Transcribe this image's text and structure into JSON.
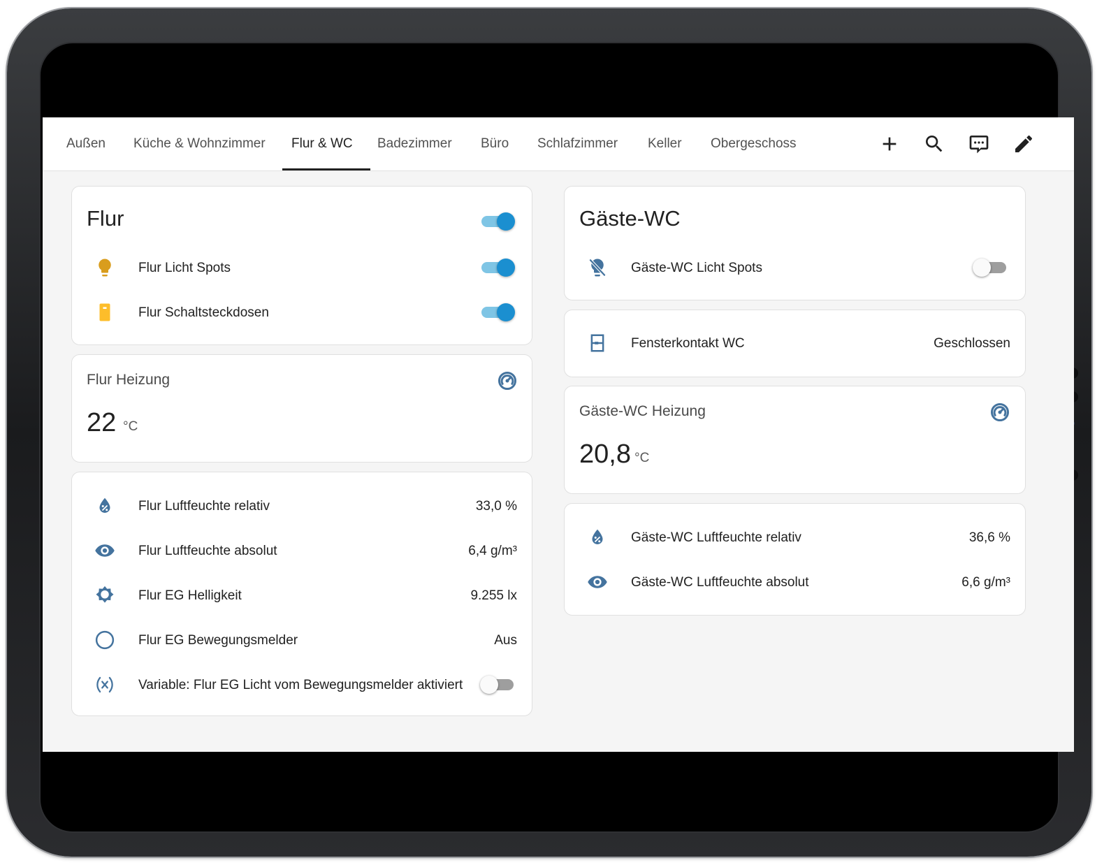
{
  "tabs": [
    {
      "label": "Außen",
      "active": false
    },
    {
      "label": "Küche & Wohnzimmer",
      "active": false
    },
    {
      "label": "Flur & WC",
      "active": true
    },
    {
      "label": "Badezimmer",
      "active": false
    },
    {
      "label": "Büro",
      "active": false
    },
    {
      "label": "Schlafzimmer",
      "active": false
    },
    {
      "label": "Keller",
      "active": false
    },
    {
      "label": "Obergeschoss",
      "active": false
    }
  ],
  "actions": {
    "add": "plus-icon",
    "search": "search-icon",
    "assist": "comment-processing-icon",
    "edit": "pencil-icon"
  },
  "colors": {
    "icon_blue": "#44739e",
    "bulb_on": "#d99d1d",
    "socket_on": "#fdbd2a",
    "toggle_on": "#1b8fd0",
    "toggle_on_track": "#7fc5e5"
  },
  "flur_card": {
    "title": "Flur",
    "master_toggle": "on",
    "rows": [
      {
        "icon": "lightbulb-icon",
        "label": "Flur Licht Spots",
        "state": "on"
      },
      {
        "icon": "power-socket-icon",
        "label": "Flur Schaltsteckdosen",
        "state": "on"
      }
    ]
  },
  "flur_heating": {
    "name": "Flur Heizung",
    "icon": "thermostat-icon",
    "value": "22",
    "unit": "°C"
  },
  "flur_sensors": {
    "rows": [
      {
        "icon": "water-percent-icon",
        "label": "Flur Luftfeuchte relativ",
        "value": "33,0 %"
      },
      {
        "icon": "eye-icon",
        "label": "Flur Luftfeuchte absolut",
        "value": "6,4 g/m³"
      },
      {
        "icon": "brightness-icon",
        "label": "Flur EG Helligkeit",
        "value": "9.255 lx"
      },
      {
        "icon": "circle-outline-icon",
        "label": "Flur EG Bewegungsmelder",
        "value": "Aus"
      },
      {
        "icon": "variable-icon",
        "label": "Variable: Flur EG Licht vom Bewegungsmelder aktiviert",
        "state": "off"
      }
    ]
  },
  "gaeste_card": {
    "title": "Gäste-WC",
    "rows": [
      {
        "icon": "lightbulb-off-icon",
        "label": "Gäste-WC Licht Spots",
        "state": "off"
      }
    ]
  },
  "window_card": {
    "icon": "window-closed-icon",
    "label": "Fensterkontakt WC",
    "value": "Geschlossen"
  },
  "gaeste_heating": {
    "name": "Gäste-WC Heizung",
    "icon": "thermostat-icon",
    "value": "20,8",
    "unit": "°C"
  },
  "gaeste_sensors": {
    "rows": [
      {
        "icon": "water-percent-icon",
        "label": "Gäste-WC Luftfeuchte relativ",
        "value": "36,6 %"
      },
      {
        "icon": "eye-icon",
        "label": "Gäste-WC Luftfeuchte absolut",
        "value": "6,6 g/m³"
      }
    ]
  }
}
